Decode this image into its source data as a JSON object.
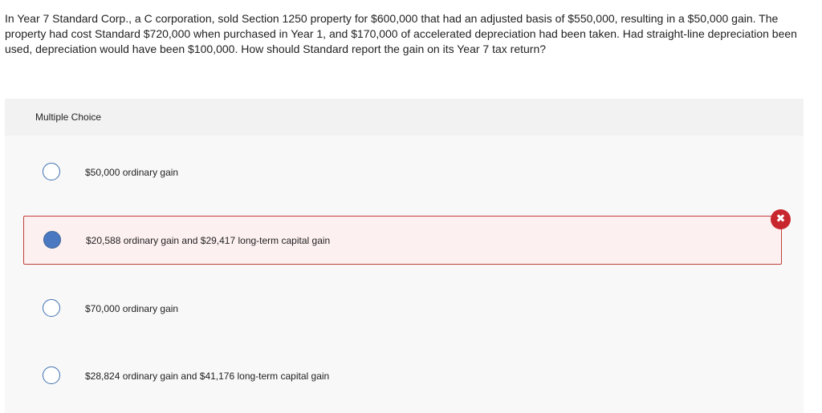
{
  "question": {
    "text": "In Year 7 Standard Corp., a C corporation, sold Section 1250 property for $600,000 that had an adjusted basis of $550,000, resulting in a $50,000 gain. The property had cost Standard $720,000 when purchased in Year 1, and $170,000 of accelerated depreciation had been taken. Had straight-line depreciation been used, depreciation would have been $100,000. How should Standard report the gain on its Year 7 tax return?"
  },
  "panel": {
    "header": "Multiple Choice"
  },
  "choices": [
    {
      "label": "$50,000 ordinary gain",
      "selected": false,
      "state": "plain"
    },
    {
      "label": "$20,588 ordinary gain and $29,417 long-term capital gain",
      "selected": true,
      "state": "incorrect"
    },
    {
      "label": "$70,000 ordinary gain",
      "selected": false,
      "state": "plain"
    },
    {
      "label": "$28,824 ordinary gain and $41,176 long-term capital gain",
      "selected": false,
      "state": "plain"
    }
  ],
  "icons": {
    "incorrect_badge": "close-icon",
    "incorrect_glyph": "✖"
  },
  "colors": {
    "radio_border": "#3d6fb0",
    "radio_selected": "#4a79c1",
    "incorrect_border": "#c0403b",
    "incorrect_background": "#fdf0f1",
    "incorrect_badge": "#c8272e"
  }
}
